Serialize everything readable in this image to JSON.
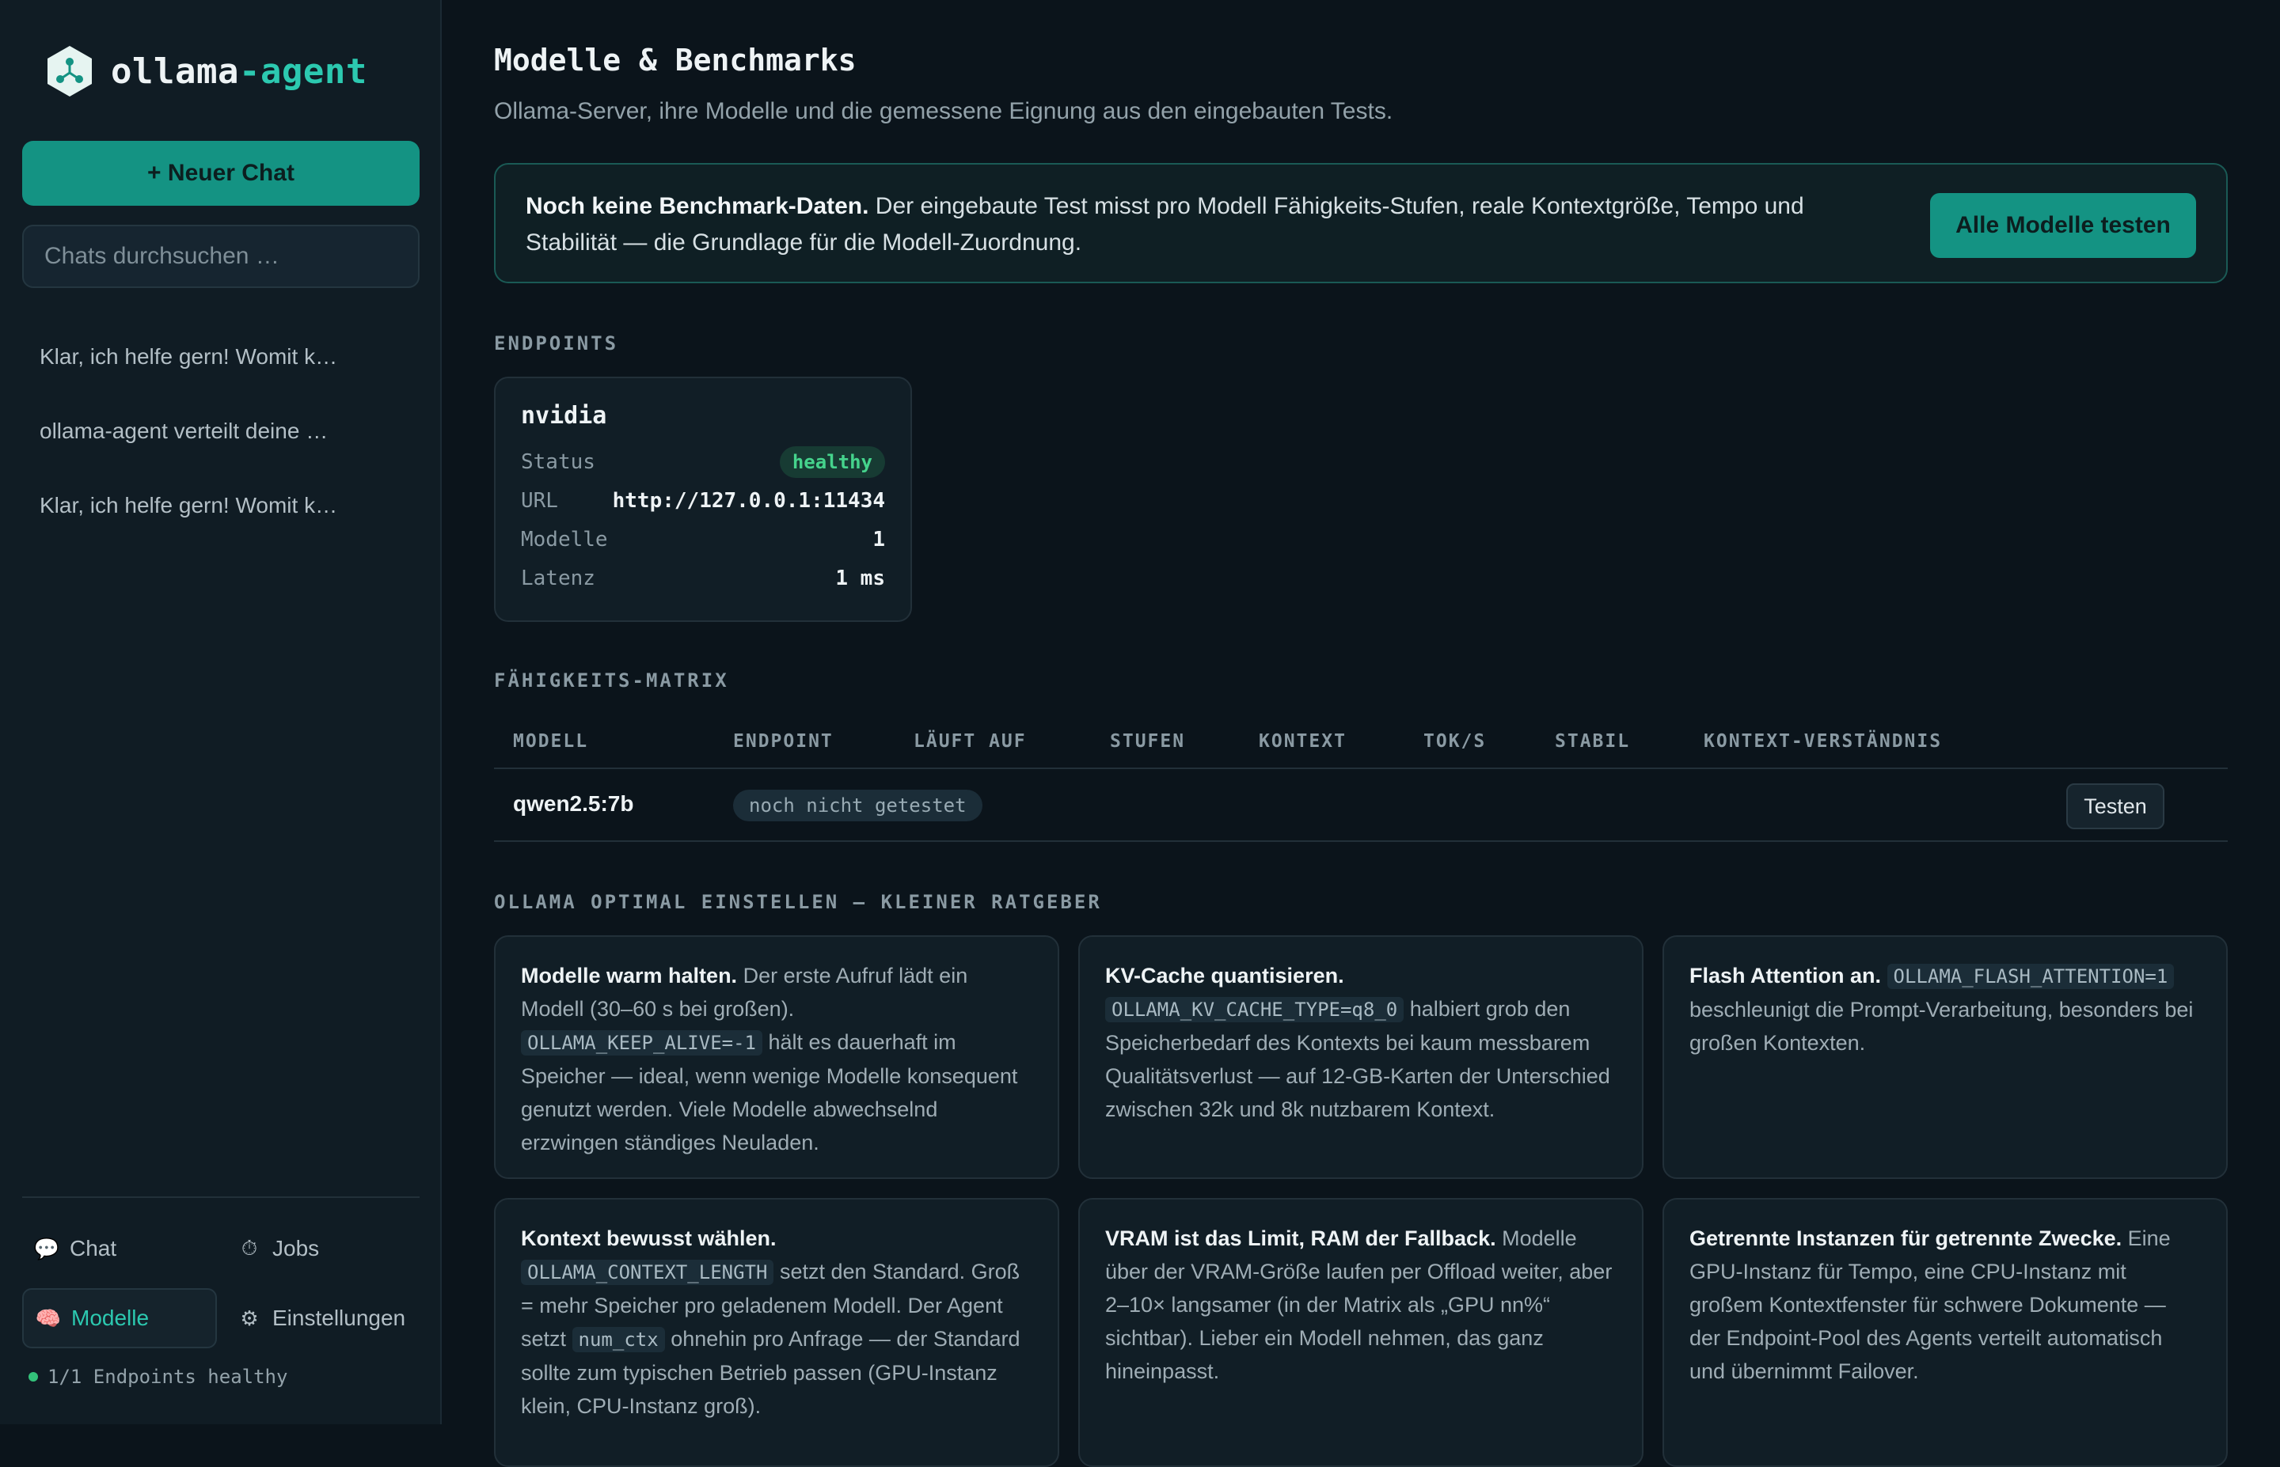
{
  "brand": {
    "name_part1": "ollama",
    "name_part2": "-agent"
  },
  "sidebar": {
    "new_chat_label": "+ Neuer Chat",
    "search_placeholder": "Chats durchsuchen …",
    "chats": [
      "Klar, ich helfe gern! Womit k…",
      "ollama-agent verteilt deine …",
      "Klar, ich helfe gern! Womit k…"
    ],
    "nav": [
      {
        "icon": "💬",
        "label": "Chat"
      },
      {
        "icon": "⏱",
        "label": "Jobs"
      },
      {
        "icon": "🧠",
        "label": "Modelle"
      },
      {
        "icon": "⚙",
        "label": "Einstellungen"
      }
    ],
    "status": "1/1 Endpoints healthy"
  },
  "main": {
    "title": "Modelle & Benchmarks",
    "subtitle": "Ollama-Server, ihre Modelle und die gemessene Eignung aus den eingebauten Tests.",
    "banner": {
      "bold": "Noch keine Benchmark-Daten.",
      "text": " Der eingebaute Test misst pro Modell Fähigkeits-Stufen, reale Kontextgröße, Tempo und Stabilität — die Grundlage für die Modell-Zuordnung.",
      "button": "Alle Modelle testen"
    },
    "endpoints_label": "ENDPOINTS",
    "endpoint": {
      "name": "nvidia",
      "status_key": "Status",
      "status_val": "healthy",
      "url_key": "URL",
      "url_val": "http://127.0.0.1:11434",
      "models_key": "Modelle",
      "models_val": "1",
      "latency_key": "Latenz",
      "latency_val": "1 ms"
    },
    "matrix_label": "FÄHIGKEITS-MATRIX",
    "matrix": {
      "headers": [
        "MODELL",
        "ENDPOINT",
        "LÄUFT AUF",
        "STUFEN",
        "KONTEXT",
        "TOK/S",
        "STABIL",
        "KONTEXT-VERSTÄNDNIS"
      ],
      "rows": [
        {
          "model": "qwen2.5:7b",
          "status": "noch nicht getestet",
          "action": "Testen"
        }
      ]
    },
    "guide_label": "OLLAMA OPTIMAL EINSTELLEN — KLEINER RATGEBER",
    "tips": [
      {
        "title": "Modelle warm halten.",
        "t1": " Der erste Aufruf lädt ein Modell (30–60 s bei großen). ",
        "code": "OLLAMA_KEEP_ALIVE=-1",
        "t2": " hält es dauerhaft im Speicher — ideal, wenn wenige Modelle konsequent genutzt werden. Viele Modelle abwechselnd erzwingen ständiges Neuladen."
      },
      {
        "title": "KV-Cache quantisieren.",
        "t1": " ",
        "code": "OLLAMA_KV_CACHE_TYPE=q8_0",
        "t2": " halbiert grob den Speicherbedarf des Kontexts bei kaum messbarem Qualitätsverlust — auf 12-GB-Karten der Unterschied zwischen 32k und 8k nutzbarem Kontext."
      },
      {
        "title": "Flash Attention an.",
        "t1": " ",
        "code": "OLLAMA_FLASH_ATTENTION=1",
        "t2": " beschleunigt die Prompt-Verarbeitung, besonders bei großen Kontexten."
      },
      {
        "title": "Kontext bewusst wählen.",
        "t1": " ",
        "code": "OLLAMA_CONTEXT_LENGTH",
        "t2": " setzt den Standard. Groß = mehr Speicher pro geladenem Modell. Der Agent setzt ",
        "code2": "num_ctx",
        "t3": " ohnehin pro Anfrage — der Standard sollte zum typischen Betrieb passen (GPU-Instanz klein, CPU-Instanz groß)."
      },
      {
        "title": "VRAM ist das Limit, RAM der Fallback.",
        "t1": " Modelle über der VRAM-Größe laufen per Offload weiter, aber 2–10× langsamer (in der Matrix als „GPU nn%“ sichtbar). Lieber ein Modell nehmen, das ganz hineinpasst."
      },
      {
        "title": "Getrennte Instanzen für getrennte Zwecke.",
        "t1": " Eine GPU-Instanz für Tempo, eine CPU-Instanz mit großem Kontextfenster für schwere Dokumente — der Endpoint-Pool des Agents verteilt automatisch und übernimmt Failover."
      }
    ]
  },
  "colors": {
    "accent": "#2cc9b0",
    "button": "#149383",
    "healthy": "#45d38c",
    "background": "#0b141b"
  }
}
